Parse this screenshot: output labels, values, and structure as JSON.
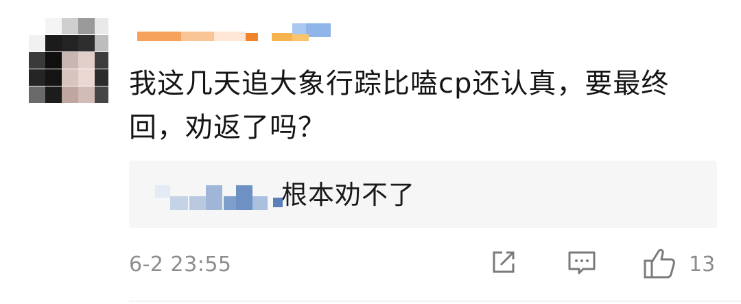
{
  "comment": {
    "text": "我这几天追大象行踪比嗑cp还认真，要最终回，劝返了吗？",
    "timestamp": "6-2 23:55",
    "like_count": "13"
  },
  "reply": {
    "text": "根本劝不了"
  },
  "icons": {
    "share": "share-icon",
    "comment": "comment-icon",
    "like": "thumbs-up-icon"
  },
  "colors": {
    "text": "#151515",
    "meta": "#8c8c8c",
    "reply_bg": "#f6f6f6",
    "username_orange": "#f0842a",
    "username_blue": "#8fb5e8"
  }
}
